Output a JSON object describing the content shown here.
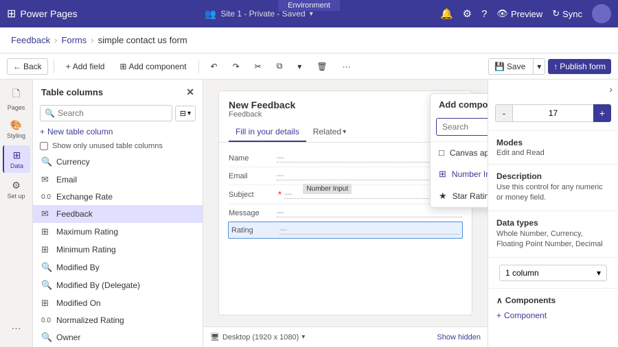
{
  "app": {
    "title": "Power Pages",
    "env_label": "Environment",
    "env_value": ""
  },
  "top_nav": {
    "site_info": "Site 1 - Private - Saved",
    "preview_label": "Preview",
    "sync_label": "Sync"
  },
  "breadcrumb": {
    "part1": "Feedback",
    "part2": "Forms",
    "part3": "simple contact us form"
  },
  "toolbar": {
    "back_label": "Back",
    "add_field_label": "Add field",
    "add_component_label": "Add component",
    "save_label": "Save",
    "publish_label": "Publish form"
  },
  "left_nav": {
    "items": [
      {
        "label": "Pages",
        "icon": "🗋"
      },
      {
        "label": "Styling",
        "icon": "🎨"
      },
      {
        "label": "Data",
        "icon": "⊞"
      },
      {
        "label": "Set up",
        "icon": "⚙"
      },
      {
        "label": "More",
        "icon": "···"
      }
    ],
    "active": "Data"
  },
  "columns_panel": {
    "title": "Table columns",
    "search_placeholder": "Search",
    "add_label": "New table column",
    "checkbox_label": "Show only unused table columns",
    "items": [
      {
        "icon": "🔍",
        "label": "Currency",
        "type": "search"
      },
      {
        "icon": "✉",
        "label": "Email",
        "type": "email"
      },
      {
        "icon": "0.0",
        "label": "Exchange Rate",
        "type": "number"
      },
      {
        "icon": "✉",
        "label": "Feedback",
        "type": "email"
      },
      {
        "icon": "⊞",
        "label": "Maximum Rating",
        "type": "grid"
      },
      {
        "icon": "⊞",
        "label": "Minimum Rating",
        "type": "grid"
      },
      {
        "icon": "🔍",
        "label": "Modified By",
        "type": "search"
      },
      {
        "icon": "🔍",
        "label": "Modified By (Delegate)",
        "type": "search"
      },
      {
        "icon": "⊞",
        "label": "Modified On",
        "type": "grid"
      },
      {
        "icon": "0.0",
        "label": "Normalized Rating",
        "type": "number"
      },
      {
        "icon": "🔍",
        "label": "Owner",
        "type": "search"
      }
    ]
  },
  "form_card": {
    "title": "New Feedback",
    "subtitle": "Feedback",
    "tab_fill": "Fill in your details",
    "tab_related": "Related",
    "fields": [
      {
        "label": "Name",
        "value": "—",
        "required": false
      },
      {
        "label": "Email",
        "value": "—",
        "required": false
      },
      {
        "label": "Subject",
        "value": "—",
        "required": true
      },
      {
        "label": "Message",
        "value": "—",
        "required": false
      },
      {
        "label": "Rating",
        "value": "—",
        "required": false,
        "highlighted": true
      }
    ]
  },
  "bottom_bar": {
    "device_icon": "🖥",
    "device_label": "Desktop (1920 x 1080)",
    "show_hidden_label": "Show hidden"
  },
  "add_component": {
    "title": "Add component",
    "search_placeholder": "Search",
    "items": [
      {
        "icon": "□",
        "label": "Canvas app",
        "type": "canvas"
      },
      {
        "icon": "⊞",
        "label": "Number Input",
        "type": "number",
        "highlighted": true
      },
      {
        "icon": "★",
        "label": "Star Rating",
        "type": "star"
      }
    ]
  },
  "number_input_badge": "Number Input",
  "right_panel": {
    "collapse_icon": "›",
    "number_minus": "-",
    "number_value": "17",
    "number_plus": "+",
    "modes_title": "Modes",
    "modes_value": "Edit and Read",
    "description_title": "Description",
    "description_text": "Use this control for any numeric or money field.",
    "data_types_title": "Data types",
    "data_types_text": "Whole Number, Currency, Floating Point Number, Decimal",
    "column_label": "1 column",
    "components_title": "Components",
    "component_add_label": "Component"
  }
}
